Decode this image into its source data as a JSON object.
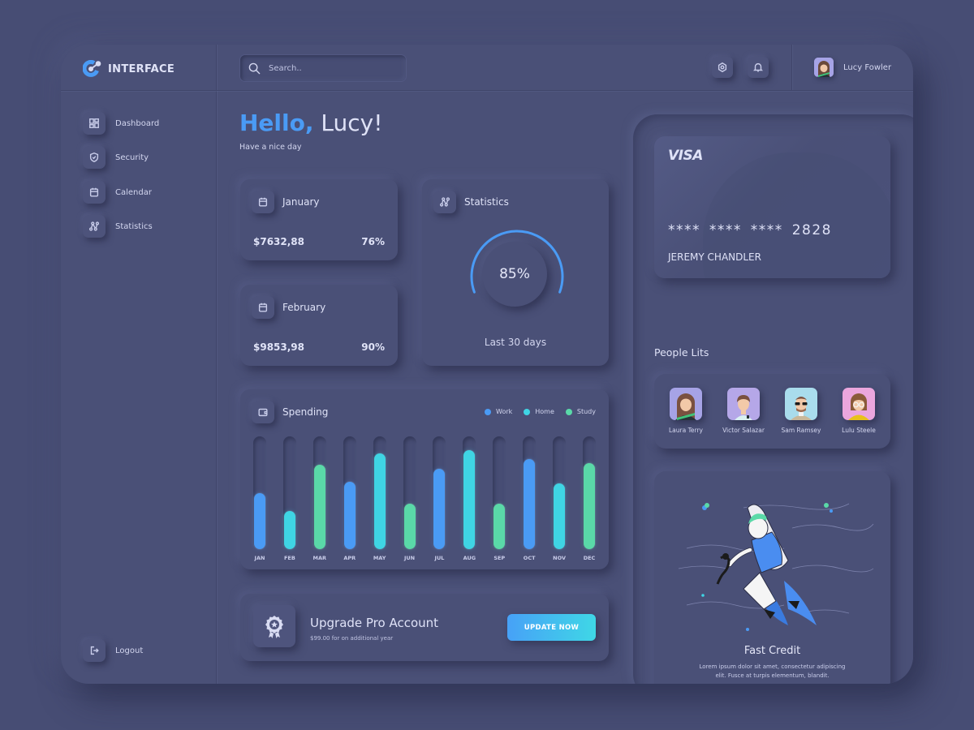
{
  "brand": {
    "name": "INTERFACE",
    "icon": "interface-logo-icon",
    "accent": "#4a9bf5"
  },
  "search": {
    "placeholder": "Search..",
    "value": ""
  },
  "topbar": {
    "settings_icon": "gear-icon",
    "notification_icon": "bell-icon"
  },
  "user": {
    "name": "Lucy Fowler",
    "avatar": "avatar-lucy"
  },
  "sidebar": {
    "items": [
      {
        "label": "Dashboard",
        "icon": "dashboard-icon"
      },
      {
        "label": "Security",
        "icon": "shield-icon"
      },
      {
        "label": "Calendar",
        "icon": "calendar-icon"
      },
      {
        "label": "Statistics",
        "icon": "statistics-icon"
      }
    ],
    "logout": {
      "label": "Logout",
      "icon": "logout-icon"
    }
  },
  "greeting": {
    "hello": "Hello,",
    "name": "Lucy!",
    "subtitle": "Have a nice day"
  },
  "months": [
    {
      "label": "January",
      "amount": "$7632,88",
      "percent": "76%"
    },
    {
      "label": "February",
      "amount": "$9853,98",
      "percent": "90%"
    }
  ],
  "statistics": {
    "title": "Statistics",
    "value_label": "85%",
    "value": 0.85,
    "footer": "Last 30 days",
    "color": "#4a9bf5"
  },
  "spending": {
    "title": "Spending",
    "legend": [
      {
        "label": "Work",
        "color": "#4a9bf5"
      },
      {
        "label": "Home",
        "color": "#3fd5e4"
      },
      {
        "label": "Study",
        "color": "#5ad9a8"
      }
    ]
  },
  "chart_data": {
    "type": "bar",
    "title": "Spending",
    "categories": [
      "JAN",
      "FEB",
      "MAR",
      "APR",
      "MAY",
      "JUN",
      "JUL",
      "AUG",
      "SEP",
      "OCT",
      "NOV",
      "DEC"
    ],
    "values": [
      0.5,
      0.34,
      0.75,
      0.6,
      0.85,
      0.4,
      0.71,
      0.88,
      0.4,
      0.8,
      0.58,
      0.76
    ],
    "series_by_bar": [
      "Work",
      "Home",
      "Study",
      "Work",
      "Home",
      "Study",
      "Work",
      "Home",
      "Study",
      "Work",
      "Home",
      "Study"
    ],
    "ylim": [
      0,
      1
    ],
    "grid": false,
    "legend_position": "top-right",
    "xlabel": "",
    "ylabel": ""
  },
  "upgrade": {
    "title": "Upgrade Pro Account",
    "subtitle": "$99.00 for on additional year",
    "button": "UPDATE NOW",
    "icon": "award-badge-icon"
  },
  "card": {
    "brand": "VISA",
    "number": "**** **** **** 2828",
    "holder": "JEREMY CHANDLER"
  },
  "people": {
    "title": "People Lits",
    "list": [
      {
        "name": "Laura Terry",
        "bg": "#a6a3e6"
      },
      {
        "name": "Victor Salazar",
        "bg": "#b5a7e8"
      },
      {
        "name": "Sam Ramsey",
        "bg": "#a9dcec"
      },
      {
        "name": "Lulu Steele",
        "bg": "#eba6dd"
      }
    ]
  },
  "credit": {
    "title": "Fast Credit",
    "text": "Lorem ipsum dolor sit amet, consectetur adipiscing elit. Fusce at turpis elementum, blandit."
  }
}
